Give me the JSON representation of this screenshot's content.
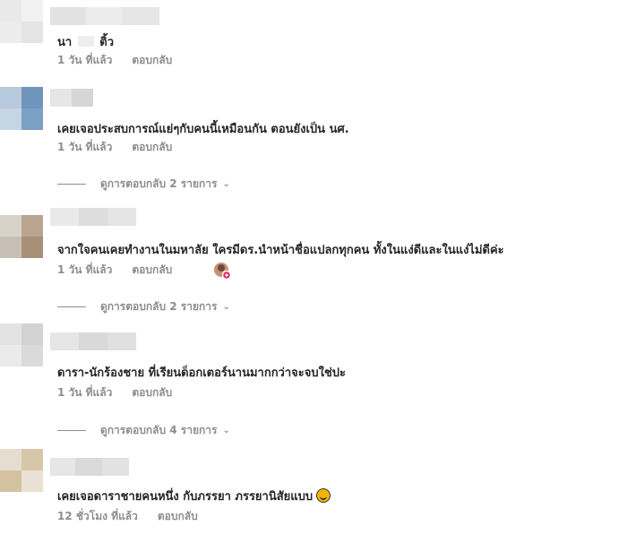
{
  "comments": [
    {
      "text_left": "นา",
      "text_right": "ติ้ว",
      "time": "1 วัน ที่แล้ว",
      "reply": "ตอบกลับ"
    },
    {
      "text": "เคยเจอประสบการณ์แย่ๆกับคนนี้เหมือนกัน ตอนยังเป็น นศ.",
      "time": "1 วัน ที่แล้ว",
      "reply": "ตอบกลับ",
      "view_replies": "ดูการตอบกลับ 2 รายการ"
    },
    {
      "text": "จากใจคนเคยทำงานในมหาลัย ใครมีดร.นำหน้าชื่อแปลกทุกคน ทั้งในแง่ดีและในแง่ไม่ดีค่ะ",
      "time": "1 วัน ที่แล้ว",
      "reply": "ตอบกลับ",
      "view_replies": "ดูการตอบกลับ 2 รายการ"
    },
    {
      "text": "ดารา-นักร้องชาย ที่เรียนด็อกเตอร์นานมากกว่าจะจบใช่ปะ",
      "time": "1 วัน ที่แล้ว",
      "reply": "ตอบกลับ",
      "view_replies": "ดูการตอบกลับ 4 รายการ"
    },
    {
      "text": "เคยเจอดาราชายคนหนึ่ง กับภรรยา ภรรยานิสัยแบบ",
      "time": "12 ชั่วโมง ที่แล้ว",
      "reply": "ตอบกลับ"
    }
  ],
  "icons": {
    "chevron": "chevron-down-icon",
    "emoji": "grinning-face-emoji-icon",
    "reaction": "reaction-avatar-icon"
  },
  "colors": {
    "meta_text": "#8e8e8e",
    "body_text": "#262626"
  }
}
